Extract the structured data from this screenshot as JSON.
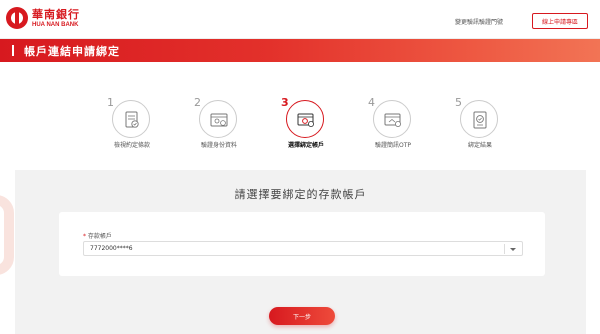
{
  "header": {
    "logo_cn": "華南銀行",
    "logo_en": "HUA NAN BANK",
    "link_label": "變更驗訊驗證門號",
    "button_label": "線上申請專區"
  },
  "page": {
    "title": "帳戶連結申請綁定"
  },
  "steps": [
    {
      "num": "1",
      "label": "檢視約定條款",
      "icon": "document-check-icon",
      "active": false
    },
    {
      "num": "2",
      "label": "驗證身份資料",
      "icon": "id-card-icon",
      "active": false
    },
    {
      "num": "3",
      "label": "選擇綁定帳戶",
      "icon": "bank-account-icon",
      "active": true
    },
    {
      "num": "4",
      "label": "驗證簡訊OTP",
      "icon": "sms-otp-icon",
      "active": false
    },
    {
      "num": "5",
      "label": "綁定結果",
      "icon": "result-check-icon",
      "active": false
    }
  ],
  "form": {
    "heading": "請選擇要綁定的存款帳戶",
    "required_mark": "*",
    "field_label": "存款帳戶",
    "selected_account": "7772000****6",
    "next_label": "下一步"
  },
  "colors": {
    "brand_red": "#d7191f",
    "panel_bg": "#f2f2f2",
    "inactive_gray": "#cccccc"
  }
}
